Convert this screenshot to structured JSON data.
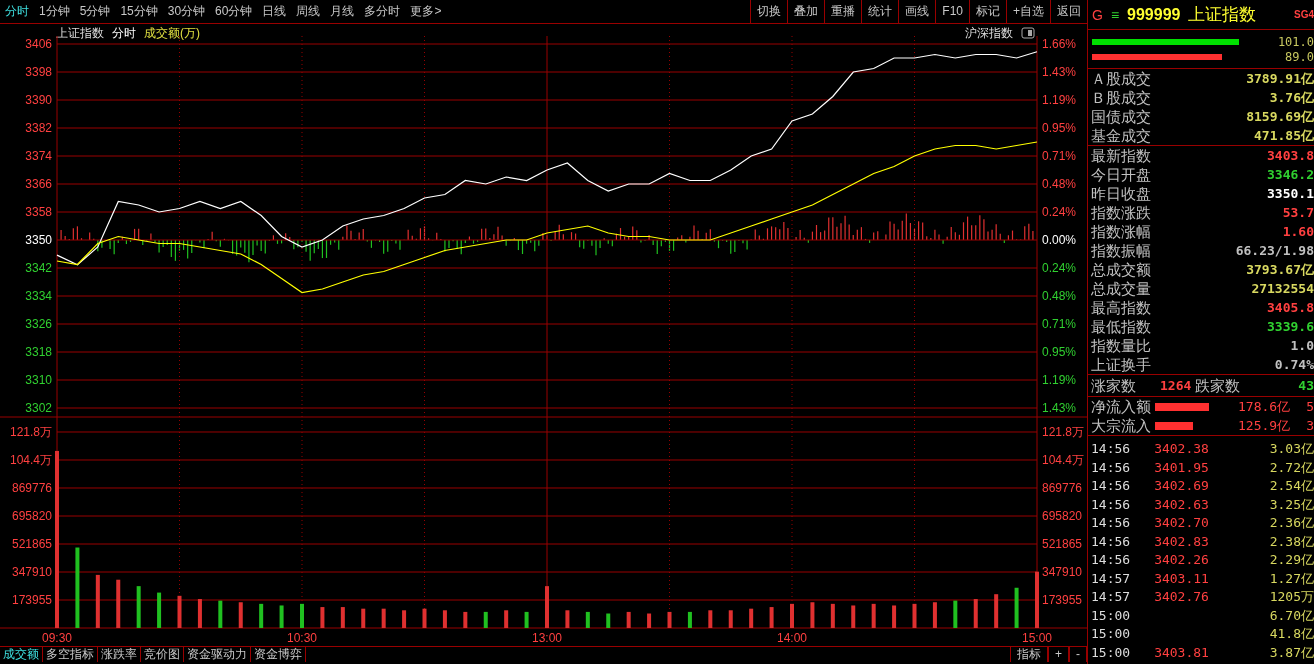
{
  "toolbar": {
    "tabs": [
      {
        "label": "分时",
        "selected": true
      },
      {
        "label": "1分钟",
        "selected": false
      },
      {
        "label": "5分钟",
        "selected": false
      },
      {
        "label": "15分钟",
        "selected": false
      },
      {
        "label": "30分钟",
        "selected": false
      },
      {
        "label": "60分钟",
        "selected": false
      },
      {
        "label": "日线",
        "selected": false
      },
      {
        "label": "周线",
        "selected": false
      },
      {
        "label": "月线",
        "selected": false
      },
      {
        "label": "多分时",
        "selected": false
      },
      {
        "label": "更多>",
        "selected": false
      }
    ],
    "buttons": [
      "切换",
      "叠加",
      "重播",
      "统计",
      "画线",
      "F10",
      "标记",
      "+自选",
      "返回"
    ]
  },
  "chart_header": {
    "index_name": "上证指数",
    "mode": "分时",
    "indicator": "成交额(万)",
    "compare_label": "沪深指数"
  },
  "price_chart": {
    "chart_data": {
      "type": "line",
      "categories": [
        null,
        null,
        null,
        null,
        null,
        null,
        null,
        null,
        null,
        null,
        null,
        null,
        null,
        null,
        null,
        null,
        null,
        null,
        null,
        null,
        null,
        null,
        null,
        null,
        null,
        null,
        null,
        null,
        null,
        null,
        null,
        null,
        null,
        null,
        null,
        null,
        null,
        null,
        null,
        null,
        null,
        null,
        null,
        null,
        null,
        null,
        null,
        null,
        null
      ],
      "series": [
        {
          "color": "#ffffff",
          "values": [
            3345.7,
            3342.9,
            3348,
            3361,
            3360,
            3358,
            3359,
            3361,
            3359,
            3361,
            3357,
            3351,
            3348,
            3350,
            3354,
            3356,
            3357,
            3359,
            3362,
            3363,
            3367,
            3366,
            3368,
            3367,
            3370,
            3372,
            3367,
            3364,
            3366,
            3366,
            3369,
            3367,
            3367,
            3370,
            3374,
            3376,
            3384,
            3386,
            3391,
            3398,
            3399,
            3402,
            3402,
            3403,
            3402,
            3403,
            3403,
            3402,
            3403.8
          ]
        },
        {
          "color": "#ffff00",
          "values": [
            3344,
            3343,
            3349,
            3351,
            3350,
            3349,
            3349,
            3348,
            3347,
            3346,
            3343,
            3339,
            3335,
            3336,
            3338,
            3340,
            3341,
            3343,
            3345,
            3347,
            3348,
            3349,
            3350,
            3350,
            3352,
            3353,
            3354,
            3352,
            3351,
            3351,
            3350,
            3350,
            3350,
            3352,
            3354,
            3356,
            3358,
            3360,
            3363,
            3366,
            3369,
            3371,
            3374,
            3376,
            3377,
            3377,
            3376,
            3377,
            3378
          ]
        }
      ],
      "ylim": [
        3302,
        3406
      ],
      "grid": true,
      "yticks": [
        {
          "value": 3406,
          "label": "3406"
        },
        {
          "value": 3398,
          "label": "3398"
        },
        {
          "value": 3390,
          "label": "3390"
        },
        {
          "value": 3382,
          "label": "3382"
        },
        {
          "value": 3374,
          "label": "3374"
        },
        {
          "value": 3366,
          "label": "3366"
        },
        {
          "value": 3358,
          "label": "3358"
        },
        {
          "value": 3350,
          "label": "3350"
        },
        {
          "value": 3342,
          "label": "3342"
        },
        {
          "value": 3334,
          "label": "3334"
        },
        {
          "value": 3326,
          "label": "3326"
        },
        {
          "value": 3318,
          "label": "3318"
        },
        {
          "value": 3310,
          "label": "3310"
        },
        {
          "value": 3302,
          "label": "3302"
        }
      ]
    },
    "percent_labels": [
      "1.66%",
      "1.43%",
      "1.19%",
      "0.95%",
      "0.71%",
      "0.48%",
      "0.24%",
      "0.00%",
      "0.24%",
      "0.48%",
      "0.71%",
      "0.95%",
      "1.19%",
      "1.43%"
    ]
  },
  "volume_chart": {
    "chart_data": {
      "type": "bar",
      "categories": [
        "09:30",
        null,
        null,
        null,
        null,
        null,
        null,
        null,
        null,
        null,
        null,
        null,
        "10:30",
        null,
        null,
        null,
        null,
        null,
        null,
        null,
        null,
        null,
        null,
        null,
        "13:00",
        null,
        null,
        null,
        null,
        null,
        null,
        null,
        null,
        null,
        null,
        null,
        "14:00",
        null,
        null,
        null,
        null,
        null,
        null,
        null,
        null,
        null,
        null,
        null,
        "15:00"
      ],
      "values": [
        1100000,
        500000,
        330000,
        300000,
        260000,
        220000,
        200000,
        180000,
        170000,
        160000,
        150000,
        140000,
        150000,
        130000,
        130000,
        120000,
        120000,
        110000,
        120000,
        110000,
        100000,
        100000,
        110000,
        100000,
        260000,
        110000,
        100000,
        90000,
        100000,
        90000,
        100000,
        100000,
        110000,
        110000,
        120000,
        130000,
        150000,
        160000,
        150000,
        140000,
        150000,
        140000,
        150000,
        160000,
        170000,
        180000,
        210000,
        250000,
        350000
      ],
      "ylim": [
        0,
        1217685
      ],
      "grid": true,
      "yticks": [
        869776,
        695820,
        521865,
        347910,
        173955
      ]
    },
    "upper_labels": [
      "121.8万",
      "104.4万"
    ],
    "right_labels": [
      "121.8万",
      "104.4万",
      "869776",
      "695820",
      "521865",
      "347910",
      "173955"
    ]
  },
  "bottom_tabs": {
    "tabs": [
      {
        "label": "成交额",
        "selected": true
      },
      {
        "label": "多空指标",
        "selected": false
      },
      {
        "label": "涨跌率",
        "selected": false
      },
      {
        "label": "竞价图",
        "selected": false
      },
      {
        "label": "资金驱动力",
        "selected": false
      },
      {
        "label": "资金博弈",
        "selected": false
      }
    ],
    "buttons": [
      "指标",
      "+",
      "-"
    ]
  },
  "quote_panel": {
    "header": {
      "market_mark": "G",
      "menu_glyph": "≡",
      "code": "999999",
      "name": "上证指数",
      "tag": "SG4"
    },
    "ratio_bars": [
      {
        "color": "#00e000",
        "value": "101.0"
      },
      {
        "color": "#ff3030",
        "value": "89.0"
      }
    ],
    "turnover": [
      {
        "label": "Ａ股成交",
        "value": "3789.91亿"
      },
      {
        "label": "Ｂ股成交",
        "value": "3.76亿"
      },
      {
        "label": "国债成交",
        "value": "8159.69亿"
      },
      {
        "label": "基金成交",
        "value": "471.85亿"
      }
    ],
    "stats": [
      {
        "label": "最新指数",
        "value": "3403.8",
        "color": "#ff4040"
      },
      {
        "label": "今日开盘",
        "value": "3346.2",
        "color": "#30d030"
      },
      {
        "label": "昨日收盘",
        "value": "3350.1",
        "color": "#ffffff"
      },
      {
        "label": "指数涨跌",
        "value": "53.7",
        "color": "#ff4040"
      },
      {
        "label": "指数涨幅",
        "value": "1.60",
        "color": "#ff4040"
      },
      {
        "label": "指数振幅",
        "value": "66.23/1.98",
        "color": "#c0c0c0"
      },
      {
        "label": "总成交额",
        "value": "3793.67亿",
        "color": "#d8d860"
      },
      {
        "label": "总成交量",
        "value": "27132554",
        "color": "#d8d860"
      },
      {
        "label": "最高指数",
        "value": "3405.8",
        "color": "#ff4040"
      },
      {
        "label": "最低指数",
        "value": "3339.6",
        "color": "#30d030"
      },
      {
        "label": "指数量比",
        "value": "1.0",
        "color": "#c0c0c0"
      },
      {
        "label": "上证换手",
        "value": "0.74%",
        "color": "#c0c0c0"
      }
    ],
    "breadth": {
      "up_label": "涨家数",
      "up_count": "1264",
      "down_label": "跌家数",
      "down_count": "43"
    },
    "flows": [
      {
        "label": "净流入额",
        "amount": "178.6亿",
        "share": "5"
      },
      {
        "label": "大宗流入",
        "amount": "125.9亿",
        "share": "3"
      }
    ],
    "ticks": [
      {
        "time": "14:56",
        "price": "3402.38",
        "volume": "3.03亿"
      },
      {
        "time": "14:56",
        "price": "3401.95",
        "volume": "2.72亿"
      },
      {
        "time": "14:56",
        "price": "3402.69",
        "volume": "2.54亿"
      },
      {
        "time": "14:56",
        "price": "3402.63",
        "volume": "3.25亿"
      },
      {
        "time": "14:56",
        "price": "3402.70",
        "volume": "2.36亿"
      },
      {
        "time": "14:56",
        "price": "3402.83",
        "volume": "2.38亿"
      },
      {
        "time": "14:56",
        "price": "3402.26",
        "volume": "2.29亿"
      },
      {
        "time": "14:57",
        "price": "3403.11",
        "volume": "1.27亿"
      },
      {
        "time": "14:57",
        "price": "3402.76",
        "volume": "1205万"
      },
      {
        "time": "15:00",
        "volume": "6.70亿"
      },
      {
        "time": "15:00",
        "volume": "41.8亿"
      },
      {
        "time": "15:00",
        "price": "3403.81",
        "volume": "3.87亿"
      }
    ]
  }
}
